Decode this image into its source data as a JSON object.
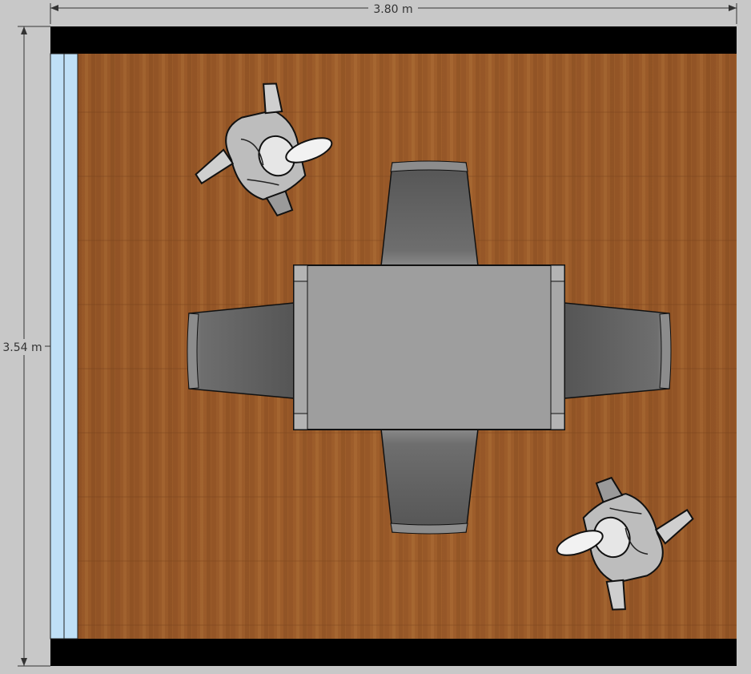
{
  "dimensions": {
    "width_label": "3.80 m",
    "height_label": "3.54 m"
  },
  "colors": {
    "background": "#c8c8c8",
    "wall": "#000000",
    "window": "#bfe0f7",
    "floor": "#9a5a2a",
    "table": "#9e9e9e",
    "chair": "#6a6a6a",
    "dimension_line": "#333333"
  },
  "objects": {
    "table": "table",
    "chairs": [
      "chair-top",
      "chair-bottom",
      "chair-left",
      "chair-right"
    ],
    "people": [
      "person-top-left",
      "person-bottom-right"
    ],
    "window": "window-left"
  }
}
